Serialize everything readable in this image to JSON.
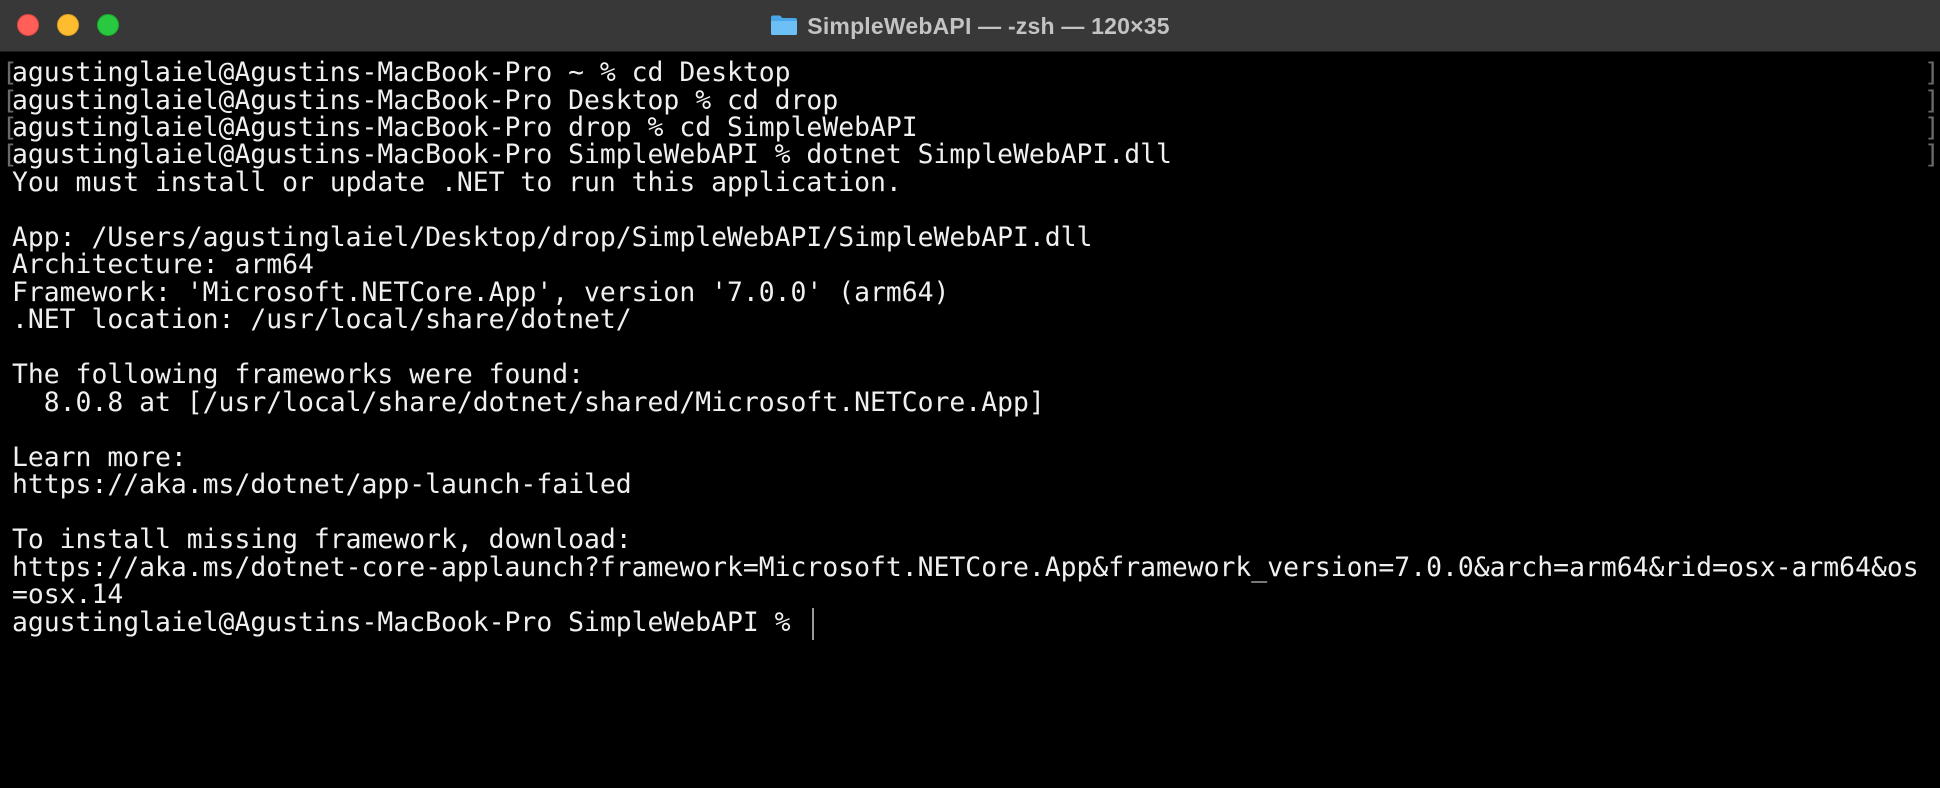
{
  "window": {
    "title": "SimpleWebAPI — -zsh — 120×35",
    "folder_icon": "folder-icon",
    "colors": {
      "close": "#ff5f57",
      "minimize": "#febc2e",
      "zoom": "#28c840",
      "titlebar": "#383838",
      "background": "#000000",
      "text": "#f0f0f0"
    }
  },
  "terminal": {
    "lines": [
      "agustinglaiel@Agustins-MacBook-Pro ~ % cd Desktop",
      "agustinglaiel@Agustins-MacBook-Pro Desktop % cd drop",
      "agustinglaiel@Agustins-MacBook-Pro drop % cd SimpleWebAPI",
      "agustinglaiel@Agustins-MacBook-Pro SimpleWebAPI % dotnet SimpleWebAPI.dll",
      "You must install or update .NET to run this application.",
      "",
      "App: /Users/agustinglaiel/Desktop/drop/SimpleWebAPI/SimpleWebAPI.dll",
      "Architecture: arm64",
      "Framework: 'Microsoft.NETCore.App', version '7.0.0' (arm64)",
      ".NET location: /usr/local/share/dotnet/",
      "",
      "The following frameworks were found:",
      "  8.0.8 at [/usr/local/share/dotnet/shared/Microsoft.NETCore.App]",
      "",
      "Learn more:",
      "https://aka.ms/dotnet/app-launch-failed",
      "",
      "To install missing framework, download:",
      "https://aka.ms/dotnet-core-applaunch?framework=Microsoft.NETCore.App&framework_version=7.0.0&arch=arm64&rid=osx-arm64&os",
      "=osx.14",
      "agustinglaiel@Agustins-MacBook-Pro SimpleWebAPI % "
    ],
    "bracket_left": "[",
    "bracket_right": "]"
  }
}
